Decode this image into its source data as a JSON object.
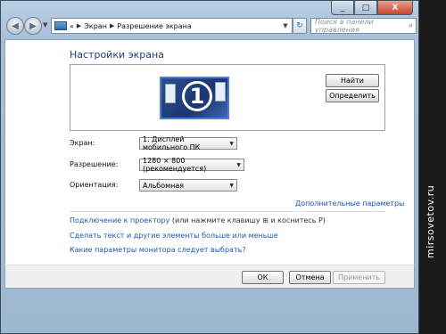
{
  "window": {
    "controls": {
      "minimize": "_",
      "maximize": "□",
      "close": "X"
    }
  },
  "nav": {
    "back_icon": "arrow-left-icon",
    "forward_icon": "arrow-right-icon",
    "address": {
      "prefix": "«",
      "crumbs": [
        "Экран",
        "Разрешение экрана"
      ],
      "separator": "▶",
      "dropdown": "▼"
    },
    "refresh": "↻",
    "search_placeholder": "Поиск в панели управления",
    "search_icon": "🔍"
  },
  "page": {
    "title": "Настройки экрана",
    "monitor_number": "1",
    "find_button": "Найти",
    "identify_button": "Определить"
  },
  "settings": {
    "display_label": "Экран:",
    "display_value": "1. Дисплей мобильного ПК",
    "resolution_label": "Разрешение:",
    "resolution_value": "1280 × 800 (рекомендуется)",
    "orientation_label": "Ориентация:",
    "orientation_value": "Альбомная",
    "advanced_link": "Дополнительные параметры"
  },
  "links": {
    "projector_link": "Подключение к проектору",
    "projector_hint_a": "(или нажмите клавишу",
    "projector_hint_b": "и коснитесь P)",
    "text_size_link": "Сделать текст и другие элементы больше или меньше",
    "monitor_help_link": "Какие параметры монитора следует выбрать?"
  },
  "footer": {
    "ok": "ОК",
    "cancel": "Отмена",
    "apply": "Применить"
  },
  "watermark": "mirsovetov.ru",
  "colors": {
    "title": "#1e3d78",
    "link": "#1a55b0",
    "monitor": "#1c3672"
  }
}
